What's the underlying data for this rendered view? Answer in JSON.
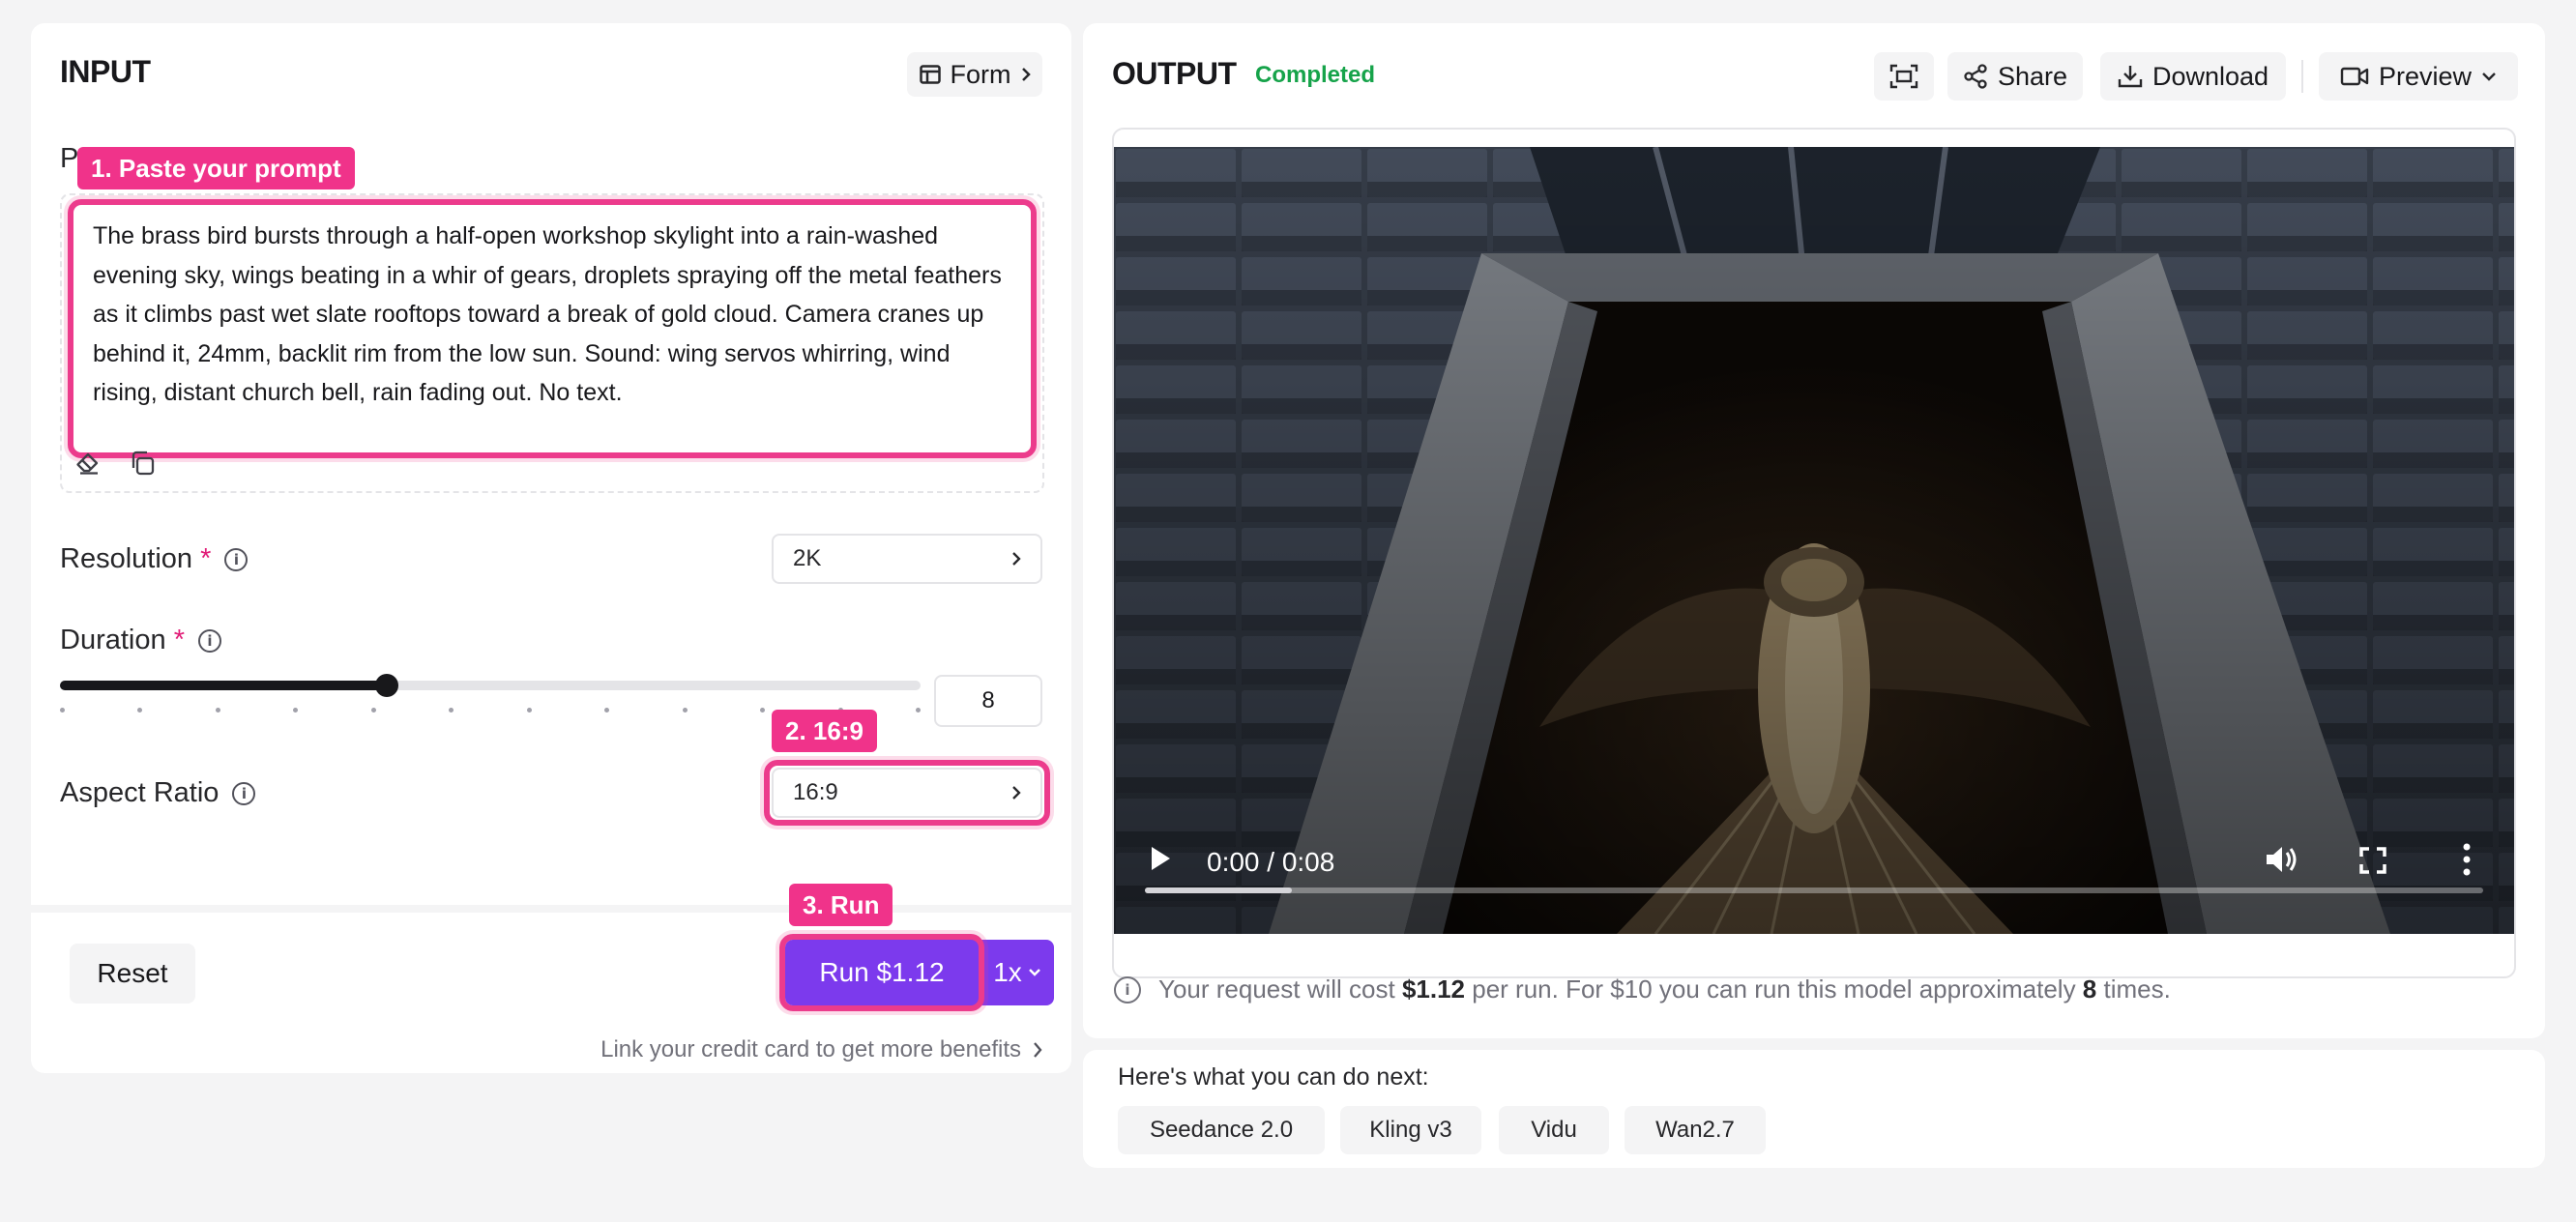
{
  "input": {
    "title": "INPUT",
    "form_label": "Form",
    "prompt_label": "Prompt",
    "prompt_text": "The brass bird bursts through a half-open workshop skylight into a rain-washed evening sky, wings beating in a whir of gears, droplets spraying off the metal feathers as it climbs past wet slate rooftops toward a break of gold cloud. Camera cranes up behind it, 24mm, backlit rim from the low sun. Sound: wing servos whirring, wind rising, distant church bell, rain fading out. No text.",
    "resolution": {
      "label": "Resolution",
      "required": "*",
      "value": "2K"
    },
    "duration": {
      "label": "Duration",
      "required": "*",
      "value": "8",
      "fraction": 0.38
    },
    "aspect_ratio": {
      "label": "Aspect Ratio",
      "value": "16:9"
    },
    "reset_label": "Reset",
    "run_label": "Run $1.12",
    "multiplier": "1x",
    "credit_link": "Link your credit card to get more benefits"
  },
  "annotations": {
    "step1": "1. Paste your prompt",
    "step2": "2. 16:9",
    "step3": "3. Run"
  },
  "output": {
    "title": "OUTPUT",
    "status": "Completed",
    "share_label": "Share",
    "download_label": "Download",
    "preview_label": "Preview",
    "video_time": "0:00 / 0:08",
    "progress_fraction": 0.11,
    "cost_prefix": "Your request will cost ",
    "cost_value": "$1.12",
    "cost_mid": " per run. For $10 you can run this model approximately ",
    "cost_times": "8",
    "cost_suffix": " times."
  },
  "next": {
    "title": "Here's what you can do next:",
    "items": [
      "Seedance 2.0",
      "Kling v3",
      "Vidu",
      "Wan2.7"
    ]
  },
  "colors": {
    "accent_pink": "#ec3b8c",
    "run_purple": "#7c3aed",
    "status_green": "#16a34a"
  }
}
